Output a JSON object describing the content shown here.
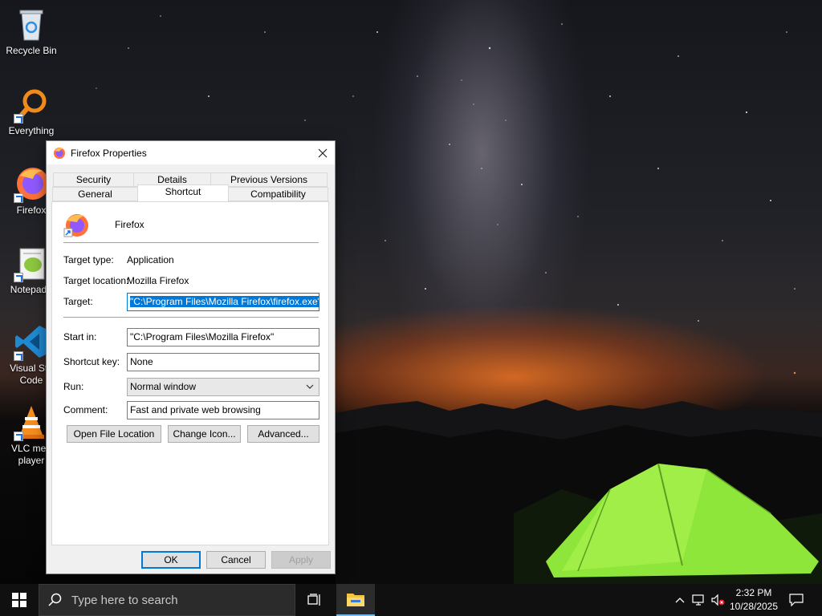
{
  "desktop": {
    "icons": [
      {
        "label": "Recycle Bin",
        "icon": "recycle-bin-icon"
      },
      {
        "label": "Everything",
        "icon": "everything-search-icon"
      },
      {
        "label": "Firefox",
        "icon": "firefox-icon"
      },
      {
        "label": "Notepad++",
        "label_visible": "Notepad+",
        "icon": "notepad-plus-plus-icon"
      },
      {
        "label_line1": "Visual Stu",
        "label_line2": "Code",
        "icon": "vscode-icon"
      },
      {
        "label_line1": "VLC med",
        "label_line2": "player",
        "icon": "vlc-icon"
      }
    ]
  },
  "dialog": {
    "title": "Firefox Properties",
    "tabs_row1": [
      "Security",
      "Details",
      "Previous Versions"
    ],
    "tabs_row2": [
      "General",
      "Shortcut",
      "Compatibility"
    ],
    "active_tab": "Shortcut",
    "app_name": "Firefox",
    "fields": {
      "target_type_label": "Target type:",
      "target_type_value": "Application",
      "target_location_label": "Target location:",
      "target_location_value": "Mozilla Firefox",
      "target_label": "Target:",
      "target_value": "\"C:\\Program Files\\Mozilla Firefox\\firefox.exe\"",
      "start_in_label": "Start in:",
      "start_in_value": "\"C:\\Program Files\\Mozilla Firefox\"",
      "shortcut_key_label": "Shortcut key:",
      "shortcut_key_value": "None",
      "run_label": "Run:",
      "run_value": "Normal window",
      "comment_label": "Comment:",
      "comment_value": "Fast and private web browsing"
    },
    "buttons": {
      "open_file_location": "Open File Location",
      "change_icon": "Change Icon...",
      "advanced": "Advanced...",
      "ok": "OK",
      "cancel": "Cancel",
      "apply": "Apply"
    }
  },
  "taskbar": {
    "search_placeholder": "Type here to search",
    "time": "2:32 PM",
    "date": "10/28/2025"
  }
}
